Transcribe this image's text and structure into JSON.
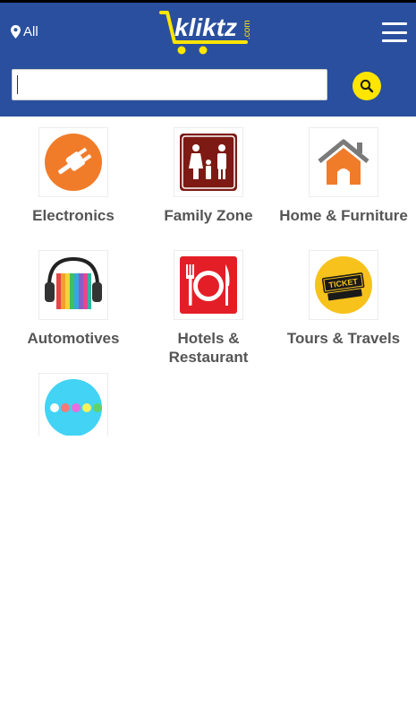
{
  "header": {
    "location_label": "All",
    "logo_text": "kliktz",
    "logo_suffix": ".com",
    "brand_color": "#2a4f9e",
    "accent_color": "#ffe500"
  },
  "search": {
    "value": "",
    "placeholder": "",
    "button_icon": "search-icon"
  },
  "categories": [
    {
      "label": "Electronics",
      "icon": "plug-icon"
    },
    {
      "label": "Family Zone",
      "icon": "family-icon"
    },
    {
      "label": "Home & Furniture",
      "icon": "house-icon"
    },
    {
      "label": "Automotives",
      "icon": "headphones-books-icon"
    },
    {
      "label": "Hotels & Restaurant",
      "icon": "plate-cutlery-icon"
    },
    {
      "label": "Tours & Travels",
      "icon": "ticket-icon"
    },
    {
      "label": "",
      "icon": "more-dots-icon"
    }
  ]
}
